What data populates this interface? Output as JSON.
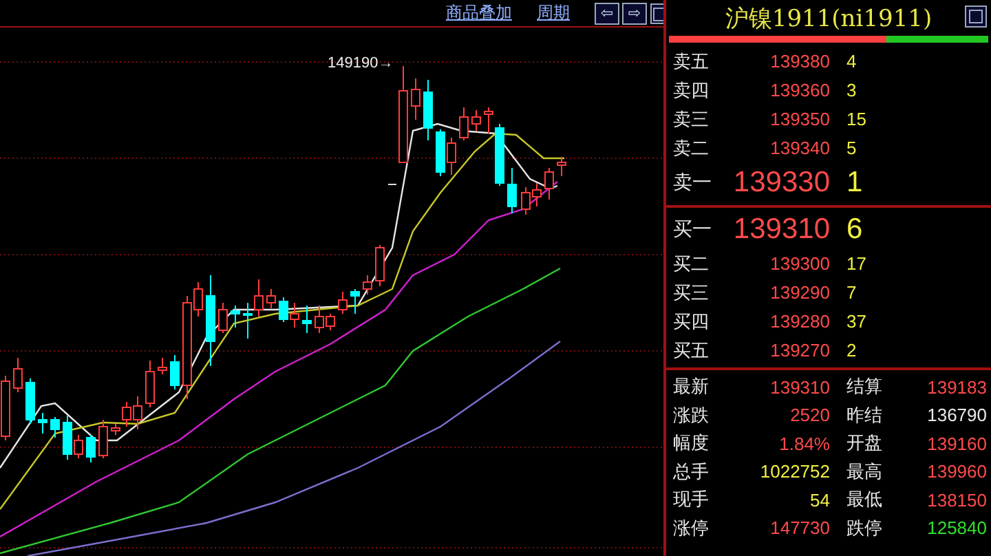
{
  "toolbar": {
    "links": [
      "商品叠加",
      "周期"
    ],
    "nav_buttons": [
      {
        "kind": "arrow",
        "label": "⇦"
      },
      {
        "kind": "arrow",
        "label": "⇨"
      },
      {
        "kind": "box"
      }
    ]
  },
  "chart": {
    "annotation": "149190→"
  },
  "quote": {
    "title": "沪镍1911(ni1911)",
    "ratio": {
      "level": 0.68
    },
    "asks": [
      {
        "label": "卖五",
        "price": "139380",
        "qty": "4",
        "kind": "level"
      },
      {
        "label": "卖四",
        "price": "139360",
        "qty": "3",
        "kind": "level"
      },
      {
        "label": "卖三",
        "price": "139350",
        "qty": "15",
        "kind": "level"
      },
      {
        "label": "卖二",
        "price": "139340",
        "qty": "5",
        "kind": "level"
      },
      {
        "label": "卖一",
        "price": "139330",
        "qty": "1",
        "kind": "best"
      }
    ],
    "bids": [
      {
        "label": "买一",
        "price": "139310",
        "qty": "6",
        "kind": "best"
      },
      {
        "label": "买二",
        "price": "139300",
        "qty": "17",
        "kind": "level"
      },
      {
        "label": "买三",
        "price": "139290",
        "qty": "7",
        "kind": "level"
      },
      {
        "label": "买四",
        "price": "139280",
        "qty": "37",
        "kind": "level"
      },
      {
        "label": "买五",
        "price": "139270",
        "qty": "2",
        "kind": "level"
      }
    ],
    "stats": [
      {
        "label": "最新",
        "value": "139310",
        "kind": "up"
      },
      {
        "label": "结算",
        "value": "139183",
        "kind": "up"
      },
      {
        "label": "涨跌",
        "value": "2520",
        "kind": "up"
      },
      {
        "label": "昨结",
        "value": "136790",
        "kind": "flat"
      },
      {
        "label": "幅度",
        "value": "1.84%",
        "kind": "up"
      },
      {
        "label": "开盘",
        "value": "139160",
        "kind": "up"
      },
      {
        "label": "总手",
        "value": "1022752",
        "kind": "volume"
      },
      {
        "label": "最高",
        "value": "139960",
        "kind": "up"
      },
      {
        "label": "现手",
        "value": "54",
        "kind": "volume"
      },
      {
        "label": "最低",
        "value": "138150",
        "kind": "up"
      },
      {
        "label": "涨停",
        "value": "147730",
        "kind": "up"
      },
      {
        "label": "跌停",
        "value": "125840",
        "kind": "down"
      }
    ]
  }
}
